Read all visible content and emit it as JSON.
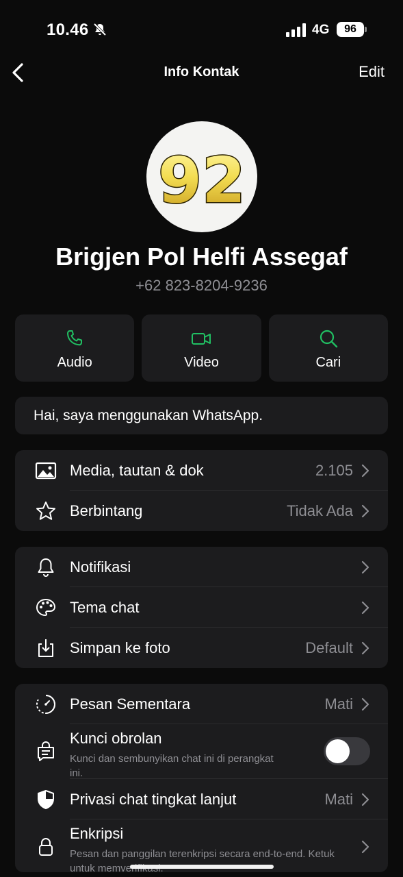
{
  "status_bar": {
    "time": "10.46",
    "network": "4G",
    "battery": "96"
  },
  "nav": {
    "title": "Info Kontak",
    "edit_label": "Edit"
  },
  "avatar": {
    "text": "92"
  },
  "contact": {
    "name": "Brigjen Pol Helfi Assegaf",
    "phone": "+62 823-8204-9236"
  },
  "actions": [
    {
      "label": "Audio",
      "icon": "phone-icon"
    },
    {
      "label": "Video",
      "icon": "video-camera-icon"
    },
    {
      "label": "Cari",
      "icon": "search-icon"
    }
  ],
  "about": {
    "text": "Hai, saya menggunakan WhatsApp."
  },
  "media_section": [
    {
      "label": "Media, tautan & dok",
      "value": "2.105",
      "icon": "image-icon"
    },
    {
      "label": "Berbintang",
      "value": "Tidak Ada",
      "icon": "star-icon"
    }
  ],
  "settings_section": [
    {
      "label": "Notifikasi",
      "value": "",
      "icon": "bell-icon"
    },
    {
      "label": "Tema chat",
      "value": "",
      "icon": "palette-icon"
    },
    {
      "label": "Simpan ke foto",
      "value": "Default",
      "icon": "download-icon"
    }
  ],
  "privacy_section": {
    "disappearing": {
      "label": "Pesan Sementara",
      "value": "Mati",
      "icon": "timer-icon"
    },
    "chat_lock": {
      "label": "Kunci obrolan",
      "sub": "Kunci dan sembunyikan chat ini di perangkat ini.",
      "icon": "lock-chat-icon",
      "enabled": false
    },
    "advanced_privacy": {
      "label": "Privasi chat tingkat lanjut",
      "value": "Mati",
      "icon": "shield-icon"
    },
    "encryption": {
      "label": "Enkripsi",
      "sub": "Pesan dan panggilan terenkripsi secara end-to-end. Ketuk untuk memverifikasi.",
      "icon": "lock-icon"
    }
  },
  "colors": {
    "accent": "#21c063",
    "background": "#0b0b0b",
    "card": "#1c1c1e",
    "secondary_text": "#8e8e93"
  }
}
